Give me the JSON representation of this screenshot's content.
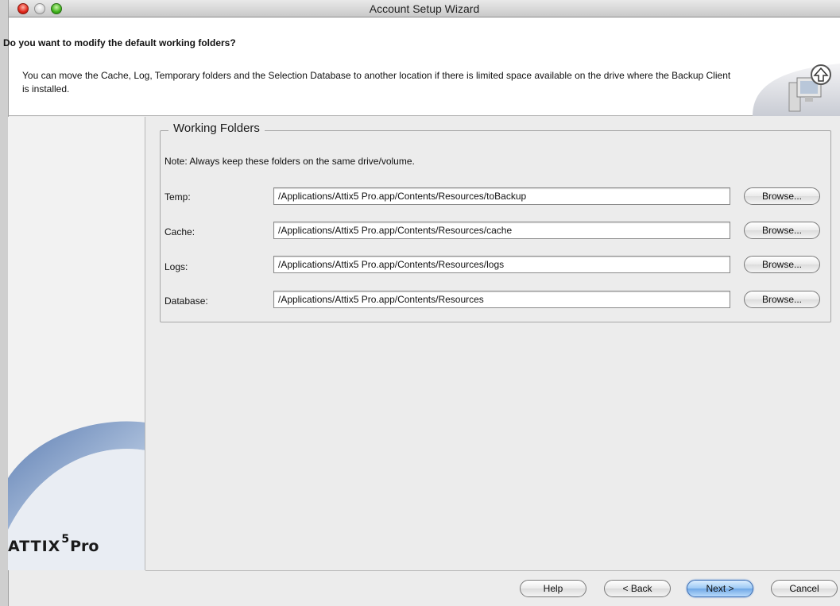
{
  "window": {
    "title": "Account Setup Wizard"
  },
  "header": {
    "question": "Do you want to modify the default working folders?",
    "description": "You can move the Cache, Log, Temporary folders and the Selection Database to another location if there is limited space available on the drive where the Backup Client is installed."
  },
  "logo": {
    "name": "ATTIX",
    "version": "5",
    "edition": "Pro"
  },
  "group": {
    "title": "Working Folders",
    "note": "Note: Always keep these folders on the same drive/volume.",
    "rows": [
      {
        "label": "Temp:",
        "value": "/Applications/Attix5 Pro.app/Contents/Resources/toBackup",
        "button": "Browse..."
      },
      {
        "label": "Cache:",
        "value": "/Applications/Attix5 Pro.app/Contents/Resources/cache",
        "button": "Browse..."
      },
      {
        "label": "Logs:",
        "value": "/Applications/Attix5 Pro.app/Contents/Resources/logs",
        "button": "Browse..."
      },
      {
        "label": "Database:",
        "value": "/Applications/Attix5 Pro.app/Contents/Resources",
        "button": "Browse..."
      }
    ]
  },
  "buttons": {
    "help": "Help",
    "back": "< Back",
    "next": "Next >",
    "cancel": "Cancel"
  },
  "colors": {
    "default_button": "#6fa7e6",
    "swoosh": "#6f8fbf"
  }
}
